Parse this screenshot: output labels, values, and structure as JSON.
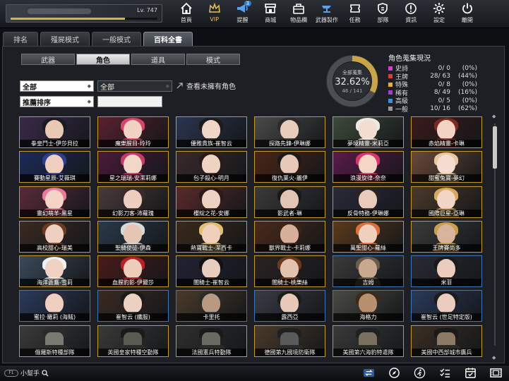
{
  "profile": {
    "level": "Lv. 747",
    "exp_fraction": 0.78
  },
  "nav": [
    {
      "id": "home",
      "label": "首頁",
      "icon": "home-icon"
    },
    {
      "id": "vip",
      "label": "VIP",
      "icon": "crown-icon",
      "gold": true
    },
    {
      "id": "announce",
      "label": "提醒",
      "icon": "megaphone-icon",
      "badge": "3"
    },
    {
      "id": "shop",
      "label": "商城",
      "icon": "shop-icon"
    },
    {
      "id": "inventory",
      "label": "物品欄",
      "icon": "bag-icon"
    },
    {
      "id": "craft",
      "label": "武器製作",
      "icon": "anvil-icon"
    },
    {
      "id": "mission",
      "label": "任務",
      "icon": "ticket-icon"
    },
    {
      "id": "clan",
      "label": "部隊",
      "icon": "shield-icon"
    },
    {
      "id": "info",
      "label": "資訊",
      "icon": "alert-icon"
    },
    {
      "id": "settings",
      "label": "設定",
      "icon": "gear-icon"
    },
    {
      "id": "exit",
      "label": "離開",
      "icon": "power-icon"
    }
  ],
  "main_tabs": [
    "排名",
    "殭屍模式",
    "一般模式",
    "百科全書"
  ],
  "main_tab_active": 3,
  "sub_tabs": [
    "武器",
    "角色",
    "道具",
    "模式"
  ],
  "sub_tab_active": 1,
  "filters": {
    "a": "全部",
    "b": "全部",
    "c": "推薦排序",
    "d": ""
  },
  "unowned_label": "查看未擁有角色",
  "collection": {
    "center_title": "全部蒐集",
    "percent": "32.62%",
    "percent_value": 32.62,
    "count": "46 / 141",
    "title": "角色蒐集現況",
    "rows": [
      {
        "name": "史詩",
        "count": "0/   0",
        "pct": "(0%)",
        "color": "#d63ec9"
      },
      {
        "name": "王牌",
        "count": "28/  63",
        "pct": "(44%)",
        "color": "#e23b3b"
      },
      {
        "name": "特殊",
        "count": "0/   8",
        "pct": "(0%)",
        "color": "#e0b13a"
      },
      {
        "name": "稀有",
        "count": "8/  49",
        "pct": "(16%)",
        "color": "#a040d0"
      },
      {
        "name": "高級",
        "count": "0/   5",
        "pct": "(0%)",
        "color": "#3b8fe0"
      },
      {
        "name": "一般",
        "count": "10/  16",
        "pct": "(62%)",
        "color": "#9a9a9a"
      }
    ],
    "ring_color": "#c9a54a"
  },
  "characters": [
    {
      "name": "拳皇鬥士-伊莎貝拉",
      "skin": "#e9c8b4",
      "hair": "#1a1a22",
      "bg": "#3a2a4a",
      "frame": "gold"
    },
    {
      "name": "魔樂腥目-玲玲",
      "skin": "#f1d2c2",
      "hair": "#d8456a",
      "bg": "#5a2030",
      "frame": "gold"
    },
    {
      "name": "優雅貴族-崔智云",
      "skin": "#f0d6c6",
      "hair": "#1b1b1b",
      "bg": "#2a3550",
      "frame": "gold"
    },
    {
      "name": "探路先鋒-伊琳娜",
      "skin": "#e8cdbd",
      "hair": "#2b2b2b",
      "bg": "#4a4a4a",
      "frame": "gold"
    },
    {
      "name": "夢境精靈-米莉亞",
      "skin": "#f3dcd0",
      "hair": "#efe9e0",
      "bg": "#3d4a3a",
      "frame": "gold"
    },
    {
      "name": "赤焰精靈-卡琳",
      "skin": "#f2d4c4",
      "hair": "#7a2a20",
      "bg": "#3a1a1a",
      "frame": "gold"
    },
    {
      "name": "賽動星辰-艾薇琪",
      "skin": "#f0cfc0",
      "hair": "#2d3e8a",
      "bg": "#1c2a5a",
      "frame": "gold"
    },
    {
      "name": "星之瑞瑞-安潔莉娜",
      "skin": "#f2d6c8",
      "hair": "#c43a6a",
      "bg": "#4a1a3a",
      "frame": "gold"
    },
    {
      "name": "包子殺心-明月",
      "skin": "#efd4c4",
      "hair": "#2a1a1a",
      "bg": "#3a2a2a",
      "frame": "gold"
    },
    {
      "name": "復仇業火-麗伊",
      "skin": "#e8c8b8",
      "hair": "#1a1a1a",
      "bg": "#4a2518",
      "frame": "gold"
    },
    {
      "name": "浪漫旋律-奈奈",
      "skin": "#f3d6c6",
      "hair": "#d8356a",
      "bg": "#5a1a4a",
      "frame": "gold"
    },
    {
      "name": "甜蜜兔寶-夢幻",
      "skin": "#f4dccf",
      "hair": "#e8c6a0",
      "bg": "#6a4a3a",
      "frame": "gold"
    },
    {
      "name": "靈幻萌羊-黑星",
      "skin": "#f3d4c6",
      "hair": "#e87a9a",
      "bg": "#5a2a3a",
      "frame": "gold"
    },
    {
      "name": "幻影刀客-沛蘿瑰",
      "skin": "#eecfbf",
      "hair": "#3a2a2a",
      "bg": "#4a3a3a",
      "frame": "gold"
    },
    {
      "name": "櫻綻之花-安娜",
      "skin": "#efd1c1",
      "hair": "#2a1a1a",
      "bg": "#5a2a2a",
      "frame": "gold"
    },
    {
      "name": "影武者-琳",
      "skin": "#e2c4b4",
      "hair": "#181818",
      "bg": "#3a3a3a",
      "frame": "gold"
    },
    {
      "name": "反骨特務-伊琳娜",
      "skin": "#e9cbbb",
      "hair": "#2a2420",
      "bg": "#2a2a3a",
      "frame": "gold"
    },
    {
      "name": "國際巨星-亞琳",
      "skin": "#f1d5c5",
      "hair": "#d8a860",
      "bg": "#4a3a2a",
      "frame": "gold"
    },
    {
      "name": "高校甜心-瑞美",
      "skin": "#efd0c0",
      "hair": "#6a3a22",
      "bg": "#3a2a22",
      "frame": "gold"
    },
    {
      "name": "聖騎使徒-伊森",
      "skin": "#e6c6b2",
      "hair": "#d8d8d8",
      "bg": "#2a3a4a",
      "frame": "gold"
    },
    {
      "name": "熱寶戰士-潔西卡",
      "skin": "#f0d0bc",
      "hair": "#e0c070",
      "bg": "#3a2a1a",
      "frame": "gold"
    },
    {
      "name": "獸界戰士-卡莉娜",
      "skin": "#d8b09a",
      "hair": "#3a2418",
      "bg": "#4a2a1a",
      "frame": "gold"
    },
    {
      "name": "萬聖甜心-蘿絲",
      "skin": "#f0cfbd",
      "hair": "#d8703a",
      "bg": "#5a3a1a",
      "frame": "gold"
    },
    {
      "name": "王牌賽尚多",
      "skin": "#d8b49c",
      "hair": "#c8a04a",
      "bg": "#3a3a3a",
      "frame": "gold"
    },
    {
      "name": "海洋蒼鷹-雪莉",
      "skin": "#efd2c2",
      "hair": "#f0f0f0",
      "bg": "#3a4a5a",
      "frame": "gold"
    },
    {
      "name": "血腥豹影-伊爾莎",
      "skin": "#ecccbb",
      "hair": "#b8202a",
      "bg": "#4a1a1a",
      "frame": "gold"
    },
    {
      "name": "闇騎士-崔智云",
      "skin": "#e8ccbe",
      "hair": "#111111",
      "bg": "#222233",
      "frame": "gold"
    },
    {
      "name": "闇騎士-桃樂絲",
      "skin": "#e4c2b0",
      "hair": "#6a3a1a",
      "bg": "#2a2222",
      "frame": "gold"
    },
    {
      "name": "吉姆",
      "skin": "#c9a890",
      "hair": "#6a5a4a",
      "bg": "#3a3a3a",
      "frame": "blue"
    },
    {
      "name": "米菲",
      "skin": "#ecccbc",
      "hair": "#1a1a1a",
      "bg": "#2a2a33",
      "frame": "blue"
    },
    {
      "name": "蜜拉·羅莉 (海賊)",
      "skin": "#efd0c0",
      "hair": "#2a2a3a",
      "bg": "#2a3a5a",
      "frame": "blue"
    },
    {
      "name": "崔智云 (纖服)",
      "skin": "#ecd0c2",
      "hair": "#1a1a1a",
      "bg": "#3a2a22",
      "frame": "blue"
    },
    {
      "name": "卡里托",
      "skin": "#b89a82",
      "hair": "#2a2a2a",
      "bg": "#4a3a2a",
      "frame": "blue"
    },
    {
      "name": "露西亞",
      "skin": "#e8c8b8",
      "hair": "#1c1c1c",
      "bg": "#3a3a44",
      "frame": "blue"
    },
    {
      "name": "海格力",
      "skin": "#b89070",
      "hair": "#3a2a1a",
      "bg": "#4a4a44",
      "frame": "blue"
    },
    {
      "name": "崔智云 (世足特定版)",
      "skin": "#ecccc0",
      "hair": "#1c1c1c",
      "bg": "#2a3a5a",
      "frame": "blue"
    },
    {
      "name": "俄羅斯特種部隊",
      "skin": "#7a7a70",
      "hair": "#2a2a2a",
      "bg": "#3a3a3a",
      "frame": "gold",
      "soldier": true
    },
    {
      "name": "英國皇家特種空勤隊",
      "skin": "#5a5a52",
      "hair": "#1a1a1a",
      "bg": "#3a3a38",
      "frame": "gold",
      "soldier": true
    },
    {
      "name": "法國憲兵特勤隊",
      "skin": "#6a6a62",
      "hair": "#1a1a1a",
      "bg": "#2e2e2e",
      "frame": "gold",
      "soldier": true
    },
    {
      "name": "德國第九國境防衛隊",
      "skin": "#5a5a5a",
      "hair": "#202020",
      "bg": "#4a3a2a",
      "frame": "gold",
      "soldier": true
    },
    {
      "name": "美國第六海豹特遣隊",
      "skin": "#7a7060",
      "hair": "#202020",
      "bg": "#3a3a3a",
      "frame": "gold",
      "soldier": true
    },
    {
      "name": "美國中西部城市鷹兵",
      "skin": "#8a7a66",
      "hair": "#1a1a1a",
      "bg": "#3a2e22",
      "frame": "gold",
      "soldier": true
    }
  ],
  "helper_label": "小幫手",
  "helper_key": "F1",
  "bottom_icons": [
    "swap-icon",
    "compass-icon",
    "run-icon",
    "checklist-icon",
    "calendar-icon",
    "film-icon"
  ]
}
